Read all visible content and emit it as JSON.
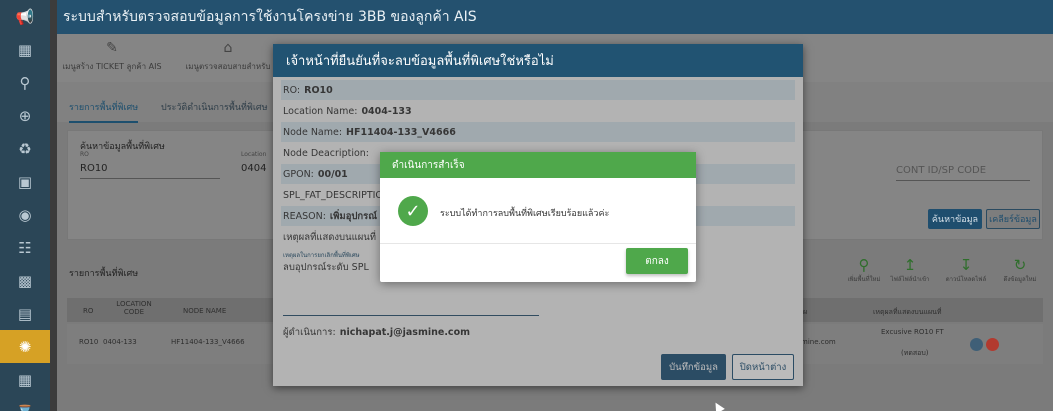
{
  "app": {
    "title": "ระบบสำหรับตรวจสอบข้อมูลการใช้งานโครงข่าย 3BB ของลูกค้า AIS"
  },
  "sidebar": {
    "icons": [
      "megaphone-icon",
      "network-icon",
      "search-icon",
      "search-plus-icon",
      "fingerprint-icon",
      "router-icon",
      "signal-icon",
      "list-check-icon",
      "device-icon",
      "printer-icon",
      "chip-icon",
      "grid-icon",
      "hourglass-icon"
    ],
    "active_index": 10
  },
  "topnav": {
    "items": [
      {
        "label": "เมนูสร้าง TICKET ลูกค้า AIS",
        "icon": "ticket-icon"
      },
      {
        "label": "เมนูตรวจสอบสายสำหรับ",
        "icon": "building-icon"
      }
    ]
  },
  "tabs": [
    {
      "label": "รายการพื้นที่พิเศษ",
      "active": true
    },
    {
      "label": "ประวัติดำเนินการพื้นที่พิเศษ",
      "active": false
    }
  ],
  "search": {
    "title": "ค้นหาข้อมูลพื้นที่พิเศษ",
    "ro_label": "RO",
    "ro_value": "RO10",
    "location_label": "Location",
    "location_value": "0404",
    "cont_placeholder": "CONT ID/SP CODE",
    "search_button": "ค้นหาข้อมูล",
    "clear_button": "เคลียร์ข้อมูล"
  },
  "list": {
    "title": "รายการพื้นที่พิเศษ",
    "tools": [
      {
        "label": "เพิ่มพื้นที่ใหม่",
        "icon": "add-area-icon"
      },
      {
        "label": "ไฟล์ไฟล์นำเข้า",
        "icon": "upload-icon"
      },
      {
        "label": "ดาวน์โหลดไฟล์",
        "icon": "download-icon"
      },
      {
        "label": "ดึงข้อมูลใหม่",
        "icon": "refresh-icon"
      }
    ],
    "columns": {
      "ro": "RO",
      "location_code": "LOCATION CODE",
      "node_name": "NODE NAME",
      "operator_suffix": "ผ",
      "reason": "เหตุผลที่แสดงบนแผนที่"
    },
    "rows": [
      {
        "ro": "RO10",
        "location": "0404-133",
        "node": "HF11404-133_V4666",
        "operator": "mine.com",
        "reason_line1": "Excusive RO10 FT",
        "reason_line2": "(ทดสอบ)"
      }
    ]
  },
  "modal": {
    "title": "เจ้าหน้าที่ยืนยันที่จะลบข้อมูลพื้นที่พิเศษใช่หรือไม่",
    "fields": {
      "ro_label": "RO:",
      "ro_value": "RO10",
      "location_label": "Location Name:",
      "location_value": "0404-133",
      "node_label": "Node Name:",
      "node_value": "HF11404-133_V4666",
      "desc_label": "Node Deacription:",
      "gpon_label": "GPON:",
      "gpon_value": "00/01",
      "spl_label": "SPL_FAT_DESCRIPTIO",
      "reason_label": "REASON:",
      "reason_value": "เพิ่มอุปกรณ์",
      "map_label": "เหตุผลที่แสดงบนแผนที่"
    },
    "reason_del_label": "เหตุผลในการยกเลิกพื้นที่พิเศษ",
    "reason_del_value": "ลบอุปกรณ์ระดับ SPL",
    "operator_label": "ผู้ดำเนินการ:",
    "operator_value": "nichapat.j@jasmine.com",
    "save_button": "บันทึกข้อมูล",
    "close_button": "ปิดหน้าต่าง"
  },
  "success": {
    "title": "ดำเนินการสำเร็จ",
    "message": "ระบบได้ทำการลบพื้นที่พิเศษเรียบร้อยแล้วค่ะ",
    "ok_button": "ตกลง"
  },
  "colors": {
    "header": "#24516f",
    "rail": "#2b4657",
    "accent": "#215372",
    "success": "#4fa84b",
    "active_rail": "#d6a125",
    "delete_red": "#c0392b"
  }
}
